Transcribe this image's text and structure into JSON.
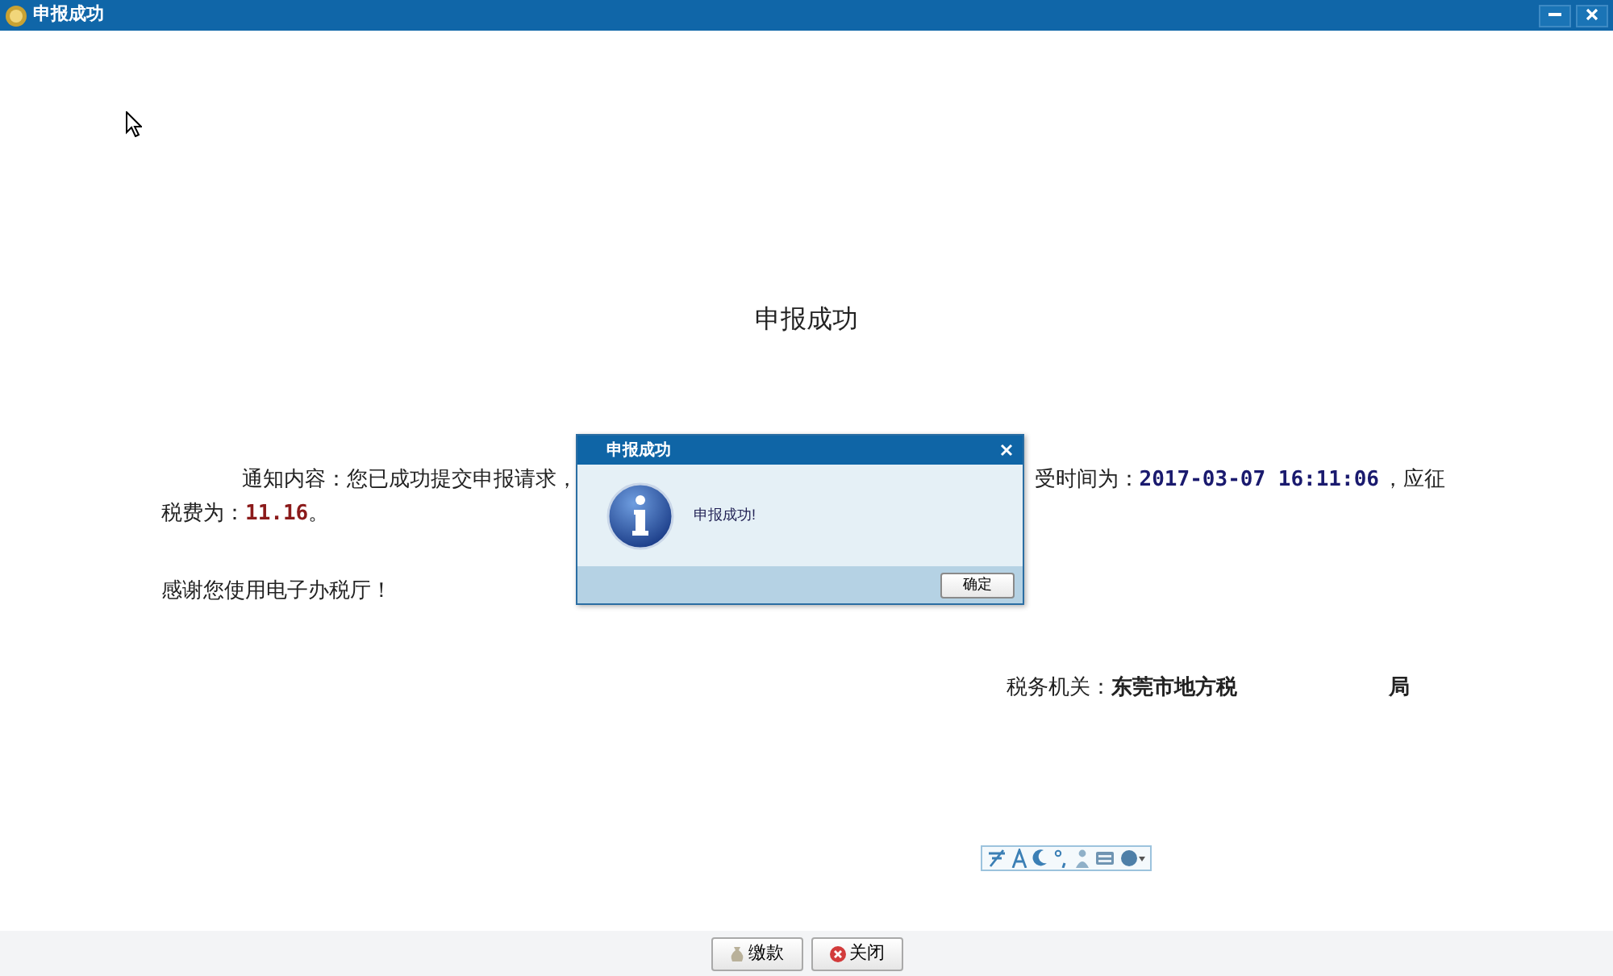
{
  "window": {
    "title": "申报成功"
  },
  "heading": "申报成功",
  "notice": {
    "line1_left": "通知内容：您已成功提交申报请求，",
    "line1_right": {
      "label": "受时间为：",
      "time": "2017-03-07 16:11:06",
      "suffix": "，应征"
    },
    "line2": {
      "label": "税费为：",
      "amount": "11.16",
      "suffix": "。"
    }
  },
  "thanks": "感谢您使用电子办税厅！",
  "authority": {
    "label": "税务机关：",
    "name": "东莞市地方税",
    "suffix": "局"
  },
  "dialog": {
    "title": "申报成功",
    "message": "申报成功!",
    "button": "确定"
  },
  "footer_buttons": [
    {
      "kind": "pay",
      "label": "缴款"
    },
    {
      "kind": "close",
      "label": "关闭"
    }
  ]
}
